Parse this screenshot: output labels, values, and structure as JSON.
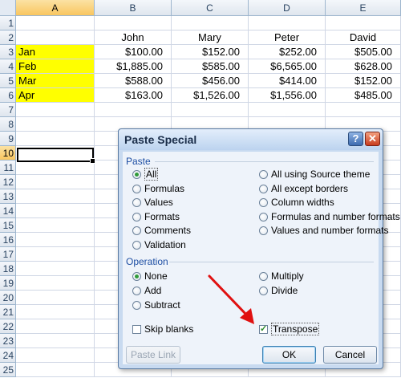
{
  "sheet": {
    "columns": [
      "A",
      "B",
      "C",
      "D",
      "E"
    ],
    "rows": [
      "1",
      "2",
      "3",
      "4",
      "5",
      "6",
      "7",
      "8",
      "9",
      "10",
      "11",
      "12",
      "13",
      "14",
      "15",
      "16",
      "17",
      "18",
      "19",
      "20",
      "21",
      "22",
      "23",
      "24",
      "25"
    ],
    "headers": [
      "John",
      "Mary",
      "Peter",
      "David"
    ],
    "data_rows": [
      {
        "label": "Jan",
        "values": [
          "$100.00",
          "$152.00",
          "$252.00",
          "$505.00"
        ]
      },
      {
        "label": "Feb",
        "values": [
          "$1,885.00",
          "$585.00",
          "$6,565.00",
          "$628.00"
        ]
      },
      {
        "label": "Mar",
        "values": [
          "$588.00",
          "$456.00",
          "$414.00",
          "$152.00"
        ]
      },
      {
        "label": "Apr",
        "values": [
          "$163.00",
          "$1,526.00",
          "$1,556.00",
          "$485.00"
        ]
      }
    ],
    "highlight_color": "#ffff00",
    "selected_row": "10",
    "selected_col": "A"
  },
  "dialog": {
    "title": "Paste Special",
    "help_label": "?",
    "close_label": "✕",
    "paste_section": "Paste",
    "paste_options": [
      {
        "label": "All",
        "selected": true
      },
      {
        "label": "Formulas",
        "selected": false
      },
      {
        "label": "Values",
        "selected": false
      },
      {
        "label": "Formats",
        "selected": false
      },
      {
        "label": "Comments",
        "selected": false
      },
      {
        "label": "Validation",
        "selected": false
      },
      {
        "label": "All using Source theme",
        "selected": false
      },
      {
        "label": "All except borders",
        "selected": false
      },
      {
        "label": "Column widths",
        "selected": false
      },
      {
        "label": "Formulas and number formats",
        "selected": false
      },
      {
        "label": "Values and number formats",
        "selected": false
      }
    ],
    "operation_section": "Operation",
    "operation_options": [
      {
        "label": "None",
        "selected": true
      },
      {
        "label": "Add",
        "selected": false
      },
      {
        "label": "Subtract",
        "selected": false
      },
      {
        "label": "Multiply",
        "selected": false
      },
      {
        "label": "Divide",
        "selected": false
      }
    ],
    "skip_blanks": {
      "label": "Skip blanks",
      "checked": false
    },
    "transpose": {
      "label": "Transpose",
      "checked": true
    },
    "paste_link_label": "Paste Link",
    "ok_label": "OK",
    "cancel_label": "Cancel"
  },
  "annotation": {
    "arrow_color": "#e01010",
    "icon": "red-arrow-icon"
  }
}
